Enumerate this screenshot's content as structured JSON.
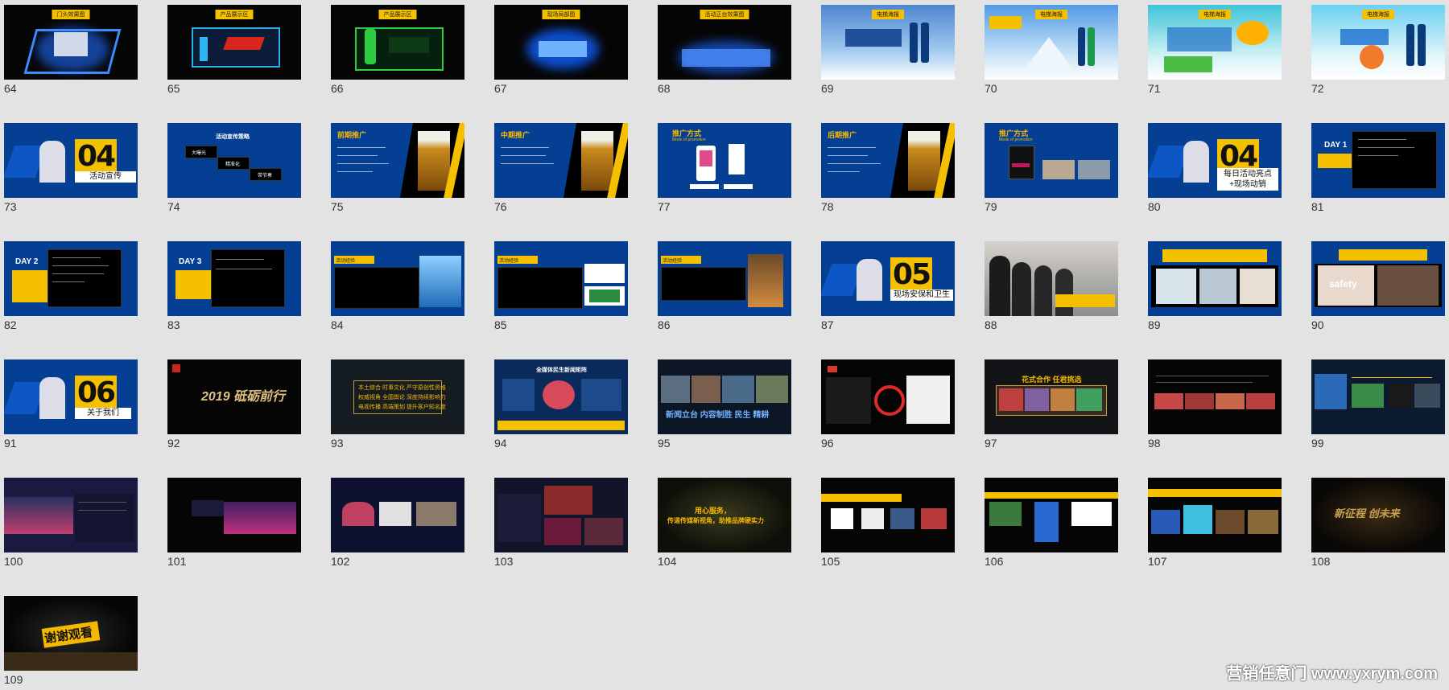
{
  "slides": [
    {
      "n": "64",
      "tag": "门头效果图"
    },
    {
      "n": "65",
      "tag": "产品展示区"
    },
    {
      "n": "66",
      "tag": "产品展示区"
    },
    {
      "n": "67",
      "tag": "现场局部图"
    },
    {
      "n": "68",
      "tag": "活动正台效果图"
    },
    {
      "n": "69",
      "tag": "电梯海报"
    },
    {
      "n": "70",
      "tag": "电梯海报"
    },
    {
      "n": "71",
      "tag": "电梯海报"
    },
    {
      "n": "72",
      "tag": "电梯海报"
    },
    {
      "n": "73",
      "big": "04",
      "caption": "活动宣传"
    },
    {
      "n": "74",
      "title": "活动宣传策略",
      "steps": [
        "大曝光",
        "精准化",
        "带节奏"
      ]
    },
    {
      "n": "75",
      "title": "前期推广"
    },
    {
      "n": "76",
      "title": "中期推广"
    },
    {
      "n": "77",
      "title": "推广方式",
      "sub": "Mode of promotion"
    },
    {
      "n": "78",
      "title": "后期推广"
    },
    {
      "n": "79",
      "title": "推广方式",
      "sub": "Mode of promotion"
    },
    {
      "n": "80",
      "big": "04",
      "caption1": "每日活动亮点",
      "caption2": "+现场动销"
    },
    {
      "n": "81",
      "day": "DAY 1"
    },
    {
      "n": "82",
      "day": "DAY 2"
    },
    {
      "n": "83",
      "day": "DAY 3"
    },
    {
      "n": "84",
      "label": "活动经验"
    },
    {
      "n": "85",
      "label": "活动经验"
    },
    {
      "n": "86",
      "label": "活动经验"
    },
    {
      "n": "87",
      "big": "05",
      "caption": "现场安保和卫生"
    },
    {
      "n": "88"
    },
    {
      "n": "89"
    },
    {
      "n": "90",
      "text": "safety"
    },
    {
      "n": "91",
      "big": "06",
      "caption": "关于我们"
    },
    {
      "n": "92",
      "text": "2019 砥砺前行"
    },
    {
      "n": "93",
      "lines": [
        "本土综合 时事文化 严守原创性资格",
        "权威视角 全国舆论 深度持续影响力",
        "电视传播 高端策划 提升客户知名度"
      ]
    },
    {
      "n": "94",
      "title": "全媒体民生新闻矩阵"
    },
    {
      "n": "95",
      "text": "新闻立台 内容制胜 民生 精耕"
    },
    {
      "n": "96"
    },
    {
      "n": "97",
      "title": "花式合作 任君挑选"
    },
    {
      "n": "98"
    },
    {
      "n": "99"
    },
    {
      "n": "100"
    },
    {
      "n": "101"
    },
    {
      "n": "102"
    },
    {
      "n": "103"
    },
    {
      "n": "104",
      "line1": "用心服务，",
      "line2": "传递传媒新视角，助推品牌硬实力"
    },
    {
      "n": "105"
    },
    {
      "n": "106"
    },
    {
      "n": "107"
    },
    {
      "n": "108",
      "text": "新征程 创未来"
    },
    {
      "n": "109",
      "text": "谢谢观看"
    }
  ],
  "watermark": "营销任意门 www.yxrym.com",
  "colors": {
    "blue": "#043f94",
    "yellow": "#f5c000",
    "black": "#050505",
    "background": "#e3e3e3"
  }
}
